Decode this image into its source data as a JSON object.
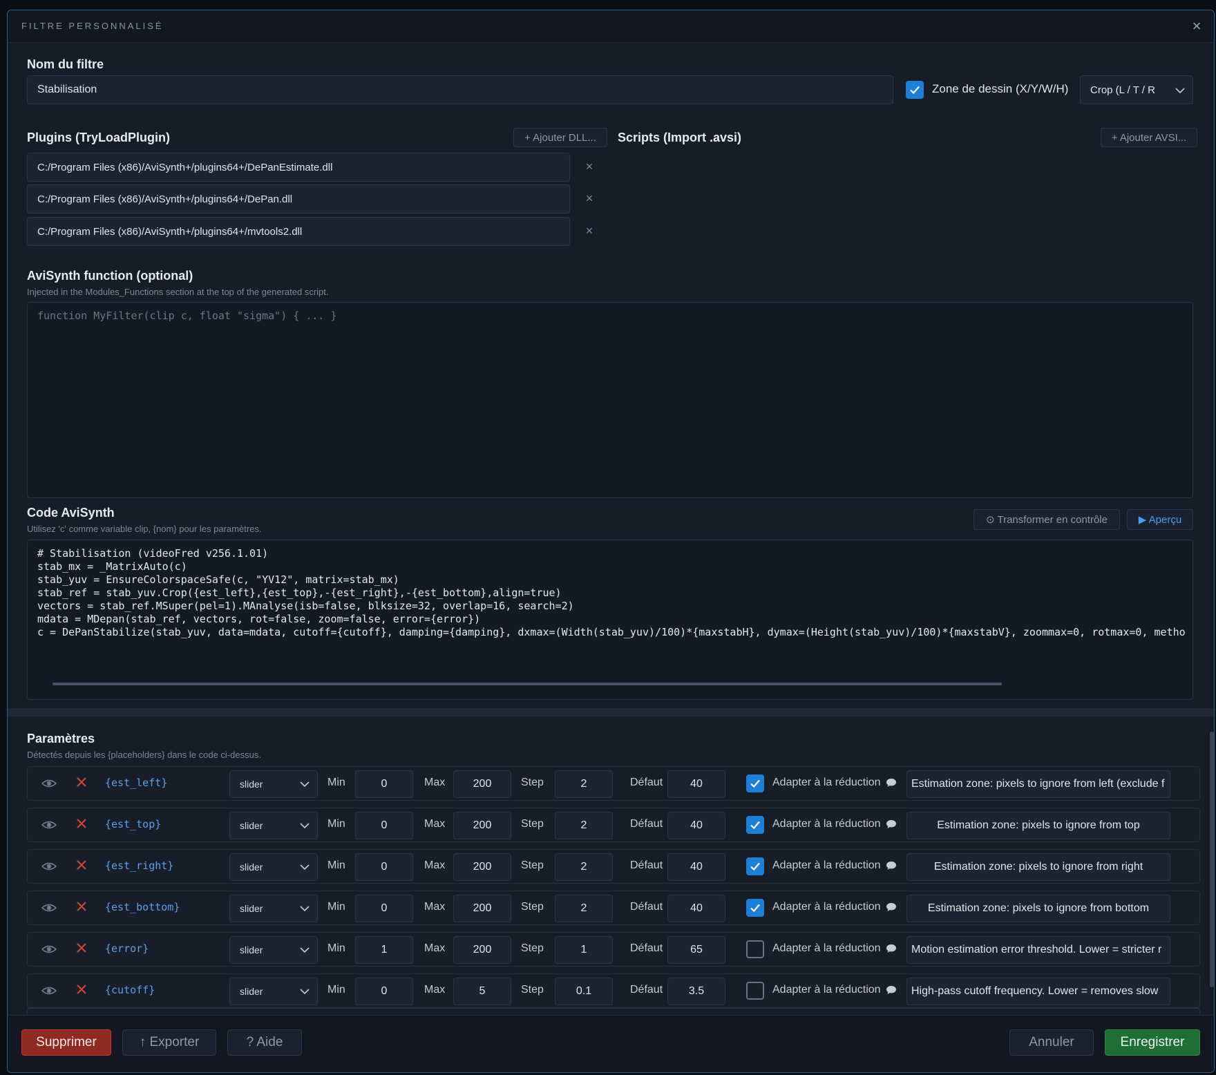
{
  "dialog": {
    "title": "FILTRE PERSONNALISÉ",
    "close_icon": "×"
  },
  "filter_name": {
    "label": "Nom du filtre",
    "value": "Stabilisation"
  },
  "draw_zone": {
    "checked": true,
    "label": "Zone de dessin (X/Y/W/H)",
    "mode_value": "Crop (L / T / R"
  },
  "plugins": {
    "label": "Plugins (TryLoadPlugin)",
    "add_label": "+ Ajouter DLL...",
    "items": [
      "C:/Program Files (x86)/AviSynth+/plugins64+/DePanEstimate.dll",
      "C:/Program Files (x86)/AviSynth+/plugins64+/DePan.dll",
      "C:/Program Files (x86)/AviSynth+/plugins64+/mvtools2.dll"
    ],
    "remove_icon": "×"
  },
  "scripts": {
    "label": "Scripts (Import .avsi)",
    "add_label": "+ Ajouter AVSI..."
  },
  "function": {
    "label": "AviSynth function (optional)",
    "hint": "Injected in the Modules_Functions section at the top of the generated script.",
    "placeholder": "function MyFilter(clip c, float \"sigma\") { ... }"
  },
  "code": {
    "label": "Code AviSynth",
    "hint": "Utilisez 'c' comme variable clip, {nom} pour les paramètres.",
    "transform_label": "⊙ Transformer en contrôle",
    "preview_label": "▶ Aperçu",
    "lines": [
      "# Stabilisation (videoFred v256.1.01)",
      "stab_mx = _MatrixAuto(c)",
      "stab_yuv = EnsureColorspaceSafe(c, \"YV12\", matrix=stab_mx)",
      "stab_ref = stab_yuv.Crop({est_left},{est_top},-{est_right},-{est_bottom},align=true)",
      "vectors = stab_ref.MSuper(pel=1).MAnalyse(isb=false, blksize=32, overlap=16, search=2)",
      "mdata = MDepan(stab_ref, vectors, rot=false, zoom=false, error={error})",
      "c = DePanStabilize(stab_yuv, data=mdata, cutoff={cutoff}, damping={damping}, dxmax=(Width(stab_yuv)/100)*{maxstabH}, dymax=(Height(stab_yuv)/100)*{maxstabV}, zoommax=0, rotmax=0, metho"
    ]
  },
  "params": {
    "label": "Paramètres",
    "hint": "Détectés depuis les {placeholders} dans le code ci-dessus.",
    "labels": {
      "min": "Min",
      "max": "Max",
      "step": "Step",
      "default": "Défaut",
      "adapt": "Adapter à la réduction"
    },
    "rows": [
      {
        "name": "{est_left}",
        "type": "slider",
        "min": "0",
        "max": "200",
        "step": "2",
        "default": "40",
        "adapt": true,
        "desc": "Estimation zone: pixels to ignore from left (exclude f",
        "center": false
      },
      {
        "name": "{est_top}",
        "type": "slider",
        "min": "0",
        "max": "200",
        "step": "2",
        "default": "40",
        "adapt": true,
        "desc": "Estimation zone: pixels to ignore from top",
        "center": true
      },
      {
        "name": "{est_right}",
        "type": "slider",
        "min": "0",
        "max": "200",
        "step": "2",
        "default": "40",
        "adapt": true,
        "desc": "Estimation zone: pixels to ignore from right",
        "center": true
      },
      {
        "name": "{est_bottom}",
        "type": "slider",
        "min": "0",
        "max": "200",
        "step": "2",
        "default": "40",
        "adapt": true,
        "desc": "Estimation zone: pixels to ignore from bottom",
        "center": true
      },
      {
        "name": "{error}",
        "type": "slider",
        "min": "1",
        "max": "200",
        "step": "1",
        "default": "65",
        "adapt": false,
        "desc": "Motion estimation error threshold. Lower = stricter r",
        "center": false
      },
      {
        "name": "{cutoff}",
        "type": "slider",
        "min": "0",
        "max": "5",
        "step": "0.1",
        "default": "3.5",
        "adapt": false,
        "desc": "High-pass cutoff frequency. Lower = removes slow",
        "center": false
      }
    ]
  },
  "footer": {
    "delete_label": "Supprimer",
    "export_label": "↑ Exporter",
    "help_label": "? Aide",
    "cancel_label": "Annuler",
    "save_label": "Enregistrer"
  },
  "colors": {
    "accent": "#1e7fd8",
    "danger": "#c0392b",
    "success": "#2e8b45",
    "param_name": "#5aa0e8"
  }
}
